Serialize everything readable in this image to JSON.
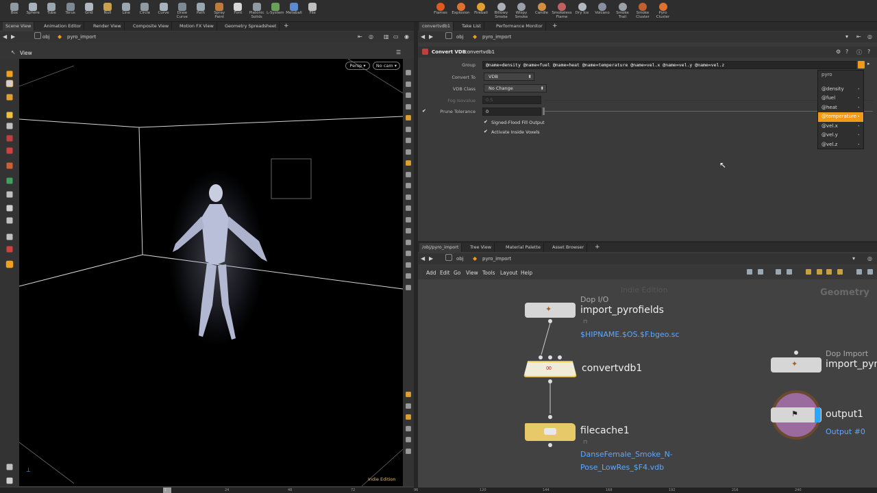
{
  "shelf": {
    "left_tools": [
      "Box",
      "Sphere",
      "Tube",
      "Torus",
      "Grid",
      "Null",
      "Line",
      "Circle",
      "Curve",
      "Draw Curve",
      "Path",
      "Spray Paint",
      "Font",
      "Platonic Solids",
      "L-System",
      "Metaball",
      "File"
    ],
    "right_tools": [
      "Flames",
      "Explosion",
      "Fireball",
      "Billowy Smoke",
      "Wispy Smoke",
      "Candle",
      "Smokeless Flame",
      "Dry Ice",
      "Volcano",
      "Smoke Trail",
      "Smoke Cluster",
      "Pyro Cluster"
    ]
  },
  "left_pane": {
    "tabs": [
      "Scene View",
      "Animation Editor",
      "Render View",
      "Composite View",
      "Motion FX View",
      "Geometry Spreadsheet"
    ],
    "path": {
      "context": "obj",
      "node": "pyro_import"
    },
    "view_title": "View",
    "camera_menu": "Persp",
    "camera_select": "No cam",
    "edition": "Indie Edition"
  },
  "params_pane": {
    "tabs": [
      "convertvdb1",
      "Take List",
      "Performance Monitor"
    ],
    "path": {
      "context": "obj",
      "node": "pyro_import"
    },
    "node_type": "Convert VDB",
    "node_name": "convertvdb1",
    "group_label": "Group",
    "group_value": "@name=density @name=fuel @name=heat @name=temperature @name=vel.x @name=vel.y @name=vel.z",
    "convert_to_label": "Convert To",
    "convert_to_value": "VDB",
    "vdb_class_label": "VDB Class",
    "vdb_class_value": "No Change",
    "fog_isovalue_label": "Fog Isovalue",
    "fog_isovalue_value": "0.5",
    "prune_tolerance_label": "Prune Tolerance",
    "prune_tolerance_value": "0",
    "signed_flood_label": "Signed-Flood Fill Output",
    "activate_inside_label": "Activate Inside Voxels",
    "group_popup": {
      "header": "pyro",
      "items": [
        "@density",
        "@fuel",
        "@heat",
        "@temperature",
        "@vel.x",
        "@vel.y",
        "@vel.z"
      ],
      "selected": "@temperature"
    }
  },
  "network_pane": {
    "tabs": [
      "/obj/pyro_import",
      "Tree View",
      "Material Palette",
      "Asset Browser"
    ],
    "path": {
      "context": "obj",
      "node": "pyro_import"
    },
    "menu": [
      "Add",
      "Edit",
      "Go",
      "View",
      "Tools",
      "Layout",
      "Help"
    ],
    "watermark": "Indie Edition",
    "context_label": "Geometry",
    "nodes": {
      "import": {
        "type": "Dop I/O",
        "name": "import_pyrofields",
        "sub": "$HIPNAME.$OS.$F.bgeo.sc"
      },
      "convert": {
        "name": "convertvdb1"
      },
      "filecache": {
        "name": "filecache1",
        "sub1": "DanseFemale_Smoke_N-",
        "sub2": "Pose_LowRes_$F4.vdb"
      },
      "dopimport": {
        "type": "Dop Import",
        "name": "import_pyr"
      },
      "output": {
        "name": "output1",
        "sub": "Output #0"
      }
    }
  },
  "timeline": {
    "ticks": [
      "1",
      "24",
      "48",
      "72",
      "96",
      "120",
      "144",
      "168",
      "192",
      "216",
      "240"
    ]
  },
  "colors": {
    "accent": "#f09a1a",
    "link": "#5ea8ff",
    "viewport_bg": "#000000"
  }
}
